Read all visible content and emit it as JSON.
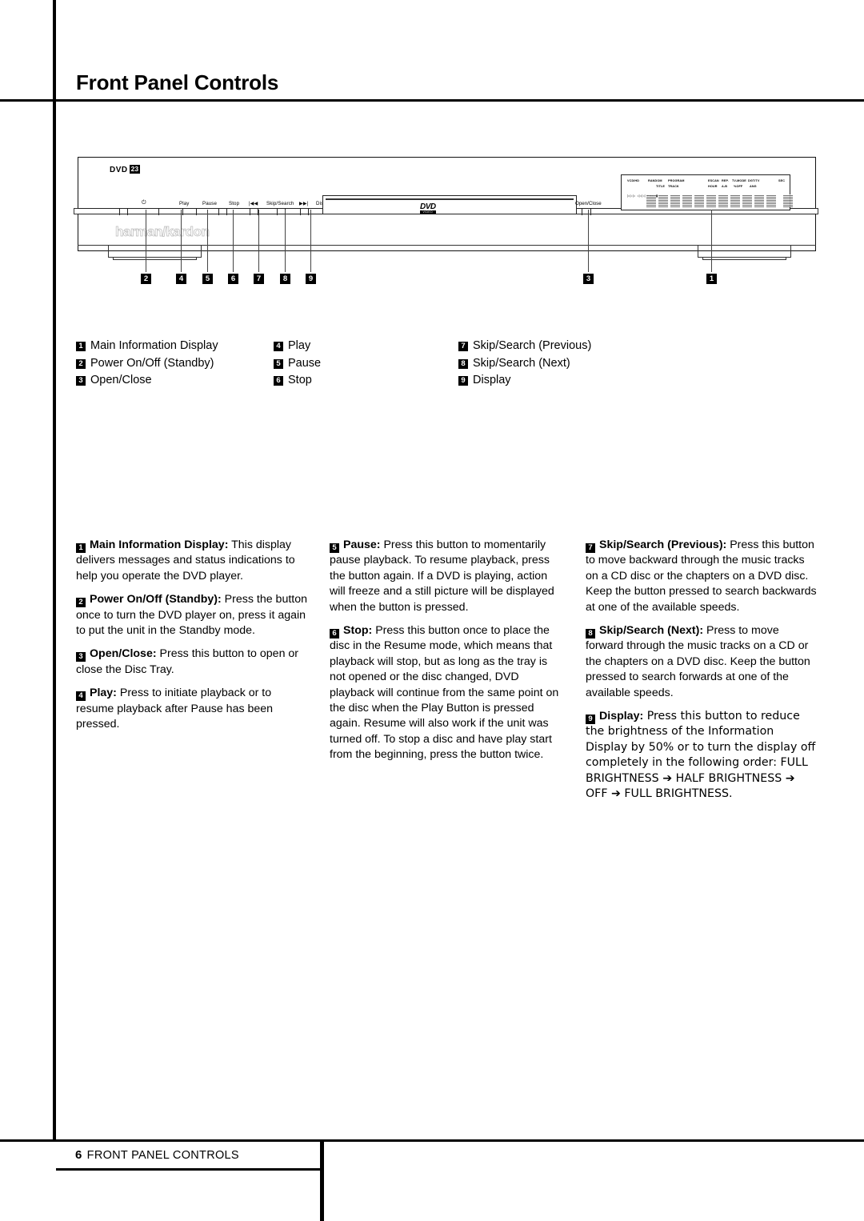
{
  "page": {
    "title": "Front Panel Controls",
    "footer_page_number": "6",
    "footer_section": "FRONT PANEL CONTROLS"
  },
  "device": {
    "badge_text": "DVD",
    "badge_version": "23",
    "brand": "harman/kardon",
    "tray_logo": "DVD",
    "tray_logo_sub": "VIDEO",
    "open_close_label": "Open/Close",
    "power_glyph": "⏻",
    "button_labels": [
      "Play",
      "Pause",
      "Stop",
      "|◀◀",
      "Skip/Search",
      "▶▶|",
      "Display"
    ],
    "display_indicators": [
      "VCD/HD",
      "RANDOM",
      "TITLE",
      "PROGRAM",
      "TRACK",
      "ESCAN",
      "HOUR",
      "REP.",
      "A-B",
      "TV-MODE",
      "%OFF",
      "DGT/TV",
      "ANG",
      "SEC"
    ],
    "display_play_arrows": "▷▷▷ ◁◁◁ PBC ▮"
  },
  "callouts": [
    {
      "n": "2"
    },
    {
      "n": "4"
    },
    {
      "n": "5"
    },
    {
      "n": "6"
    },
    {
      "n": "7"
    },
    {
      "n": "8"
    },
    {
      "n": "9"
    },
    {
      "n": "3"
    },
    {
      "n": "1"
    }
  ],
  "legend": {
    "col1": [
      {
        "n": "1",
        "label": "Main Information Display"
      },
      {
        "n": "2",
        "label": "Power On/Off (Standby)"
      },
      {
        "n": "3",
        "label": "Open/Close"
      }
    ],
    "col2": [
      {
        "n": "4",
        "label": "Play"
      },
      {
        "n": "5",
        "label": "Pause"
      },
      {
        "n": "6",
        "label": "Stop"
      }
    ],
    "col3": [
      {
        "n": "7",
        "label": "Skip/Search (Previous)"
      },
      {
        "n": "8",
        "label": "Skip/Search (Next)"
      },
      {
        "n": "9",
        "label": "Display"
      }
    ]
  },
  "descriptions": {
    "col1": [
      {
        "n": "1",
        "term": "Main Information Display:",
        "text": " This display delivers messages and status indications to help you operate the DVD player."
      },
      {
        "n": "2",
        "term": "Power On/Off (Standby):",
        "text": " Press the button once to turn the DVD player on, press it again to put the unit in the Standby mode."
      },
      {
        "n": "3",
        "term": "Open/Close:",
        "text": " Press this button to open or close the Disc Tray."
      },
      {
        "n": "4",
        "term": "Play:",
        "text": " Press to initiate playback or to resume playback after Pause has been pressed."
      }
    ],
    "col2": [
      {
        "n": "5",
        "term": "Pause:",
        "text": " Press this button to momentarily pause playback. To resume playback, press the button again. If a DVD is playing, action will freeze and a still picture will be displayed when the button is pressed."
      },
      {
        "n": "6",
        "term": "Stop:",
        "text": " Press this button once to place the disc in the Resume mode, which means that playback will stop, but as long as the tray is not opened or the disc changed, DVD playback will continue from the same point on the disc when the Play Button is pressed again. Resume will also work if the unit was turned off. To stop a disc and have play start from the beginning, press the button twice."
      }
    ],
    "col3": [
      {
        "n": "7",
        "term": "Skip/Search (Previous):",
        "text": " Press this button to move backward through the music tracks on a CD disc or the chapters on a DVD disc. Keep the button pressed to search backwards at one of the available speeds."
      },
      {
        "n": "8",
        "term": "Skip/Search (Next):",
        "text": " Press to move forward through the music tracks on a CD or the chapters on a DVD disc. Keep the button pressed to search forwards at one of the available speeds."
      },
      {
        "n": "9",
        "term": "Display:",
        "text": " Press this button to reduce the brightness of the Information Display by 50% or to turn the display off completely in the following order: FULL BRIGHTNESS ➔ HALF BRIGHTNESS ➔ OFF ➔ FULL BRIGHTNESS."
      }
    ]
  }
}
